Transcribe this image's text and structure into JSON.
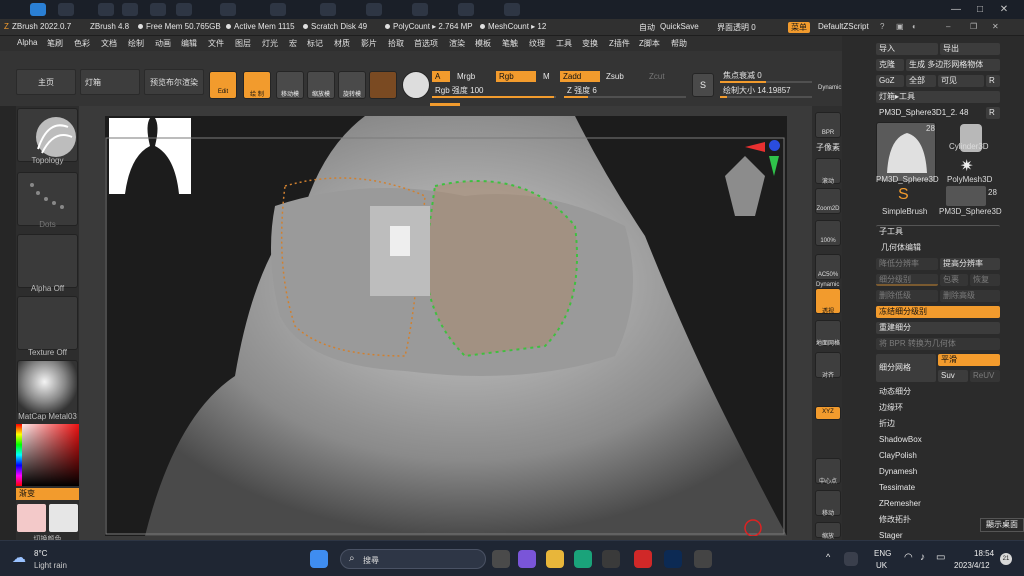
{
  "titlebar": {
    "app": "ZBrush 2022.0.7",
    "version": "ZBrush 4.8",
    "free_mem": "Free Mem 50.765GB",
    "active_mem": "Active Mem 1115",
    "scratch": "Scratch Disk 49",
    "polycount": "PolyCount ▸ 2.764 MP",
    "meshcount": "MeshCount ▸ 12",
    "auto": "自动",
    "quicksave": "QuickSave",
    "transparency": "界面透明 0",
    "menu": "菜单",
    "script": "DefaultZScript"
  },
  "menubar": [
    "Alpha",
    "笔刷",
    "色彩",
    "文档",
    "绘制",
    "动画",
    "编辑",
    "文件",
    "图层",
    "灯光",
    "宏",
    "标记",
    "材质",
    "影片",
    "拾取",
    "首选项",
    "渲染",
    "模板",
    "笔触",
    "纹理",
    "工具",
    "变换",
    "Z插件",
    "Z脚本",
    "帮助"
  ],
  "shelf": {
    "home": "主页",
    "lightbox": "灯箱",
    "bpr": "预览布尔渲染",
    "edit": "Edit",
    "draw": "绘 制",
    "move": "移动模",
    "scale": "缩放模",
    "rotate": "旋转模",
    "a": "A",
    "mrgb": "Mrgb",
    "rgb": "Rgb",
    "m": "M",
    "zadd": "Zadd",
    "zsub": "Zsub",
    "zcut": "Zcut",
    "rgb_intensity": "Rgb 强度 100",
    "z_intensity": "Z 强度 6",
    "s": "S",
    "focal": "焦点衰减 0",
    "draw_size": "绘制大小 14.19857",
    "dynamic": "Dynamic"
  },
  "leftpanel": {
    "brush": "Topology",
    "stroke": "Dots",
    "alpha": "Alpha Off",
    "texture": "Texture Off",
    "material": "MatCap Metal03",
    "gradient": "渐变",
    "swap": "切换颜色"
  },
  "rshelf": [
    "BPR",
    "子像素",
    "滚动",
    "Zoom2D",
    "100%",
    "AC50%",
    "透视",
    "地面网格",
    "对齐",
    "XYZ",
    "",
    "",
    "中心点",
    "移动",
    "缩放"
  ],
  "rshelf_dynamic": "Dynamic",
  "rpanel": {
    "import": "导入",
    "export": "导出",
    "clone": "克隆",
    "make_polymesh": "生成 多边形网格物体",
    "goz": "GoZ",
    "all": "全部",
    "visible": "可见",
    "r": "R",
    "lightbox_tool": "灯箱▸工具",
    "current_tool": "PM3D_Sphere3D1_2. 48",
    "current_r": "R",
    "tools": [
      {
        "name": "PM3D_Sphere3D",
        "count": "28"
      },
      {
        "name": "Cylinder3D",
        "count": ""
      },
      {
        "name": "PolyMesh3D",
        "count": ""
      },
      {
        "name": "SimpleBrush",
        "count": ""
      },
      {
        "name": "PM3D_Sphere3D",
        "count": "28"
      }
    ],
    "subtool": "子工具",
    "geometry": "几何体编辑",
    "lower_res": "降低分辨率",
    "higher_res": "提高分辨率",
    "sdiv": "细分级别",
    "cage": "包裹",
    "rstr": "恢复",
    "del_lower": "删除低级",
    "del_higher": "删除高级",
    "freeze": "冻结细分级别",
    "reconstruct": "重建细分",
    "bpr_to_geo": "将 BPR 转换为几何体",
    "divide": "细分网格",
    "smooth": "平滑",
    "suv": "Suv",
    "reuv": "ReUV",
    "sections": [
      "动态细分",
      "边缘环",
      "折边",
      "ShadowBox",
      "ClayPolish",
      "Dynamesh",
      "Tessimate",
      "ZRemesher",
      "修改拓扑",
      "Stager"
    ]
  },
  "canvas": {
    "gizmo_colors": {
      "x": "#e83030",
      "y": "#2fc24a",
      "z": "#2a4de0"
    }
  },
  "taskbar": {
    "temp": "8°C",
    "weather": "Light rain",
    "search": "搜尋",
    "lang1": "ENG",
    "lang2": "UK",
    "time": "18:54",
    "date": "2023/4/12",
    "badge": "21"
  },
  "tooltip": "顯示桌面"
}
